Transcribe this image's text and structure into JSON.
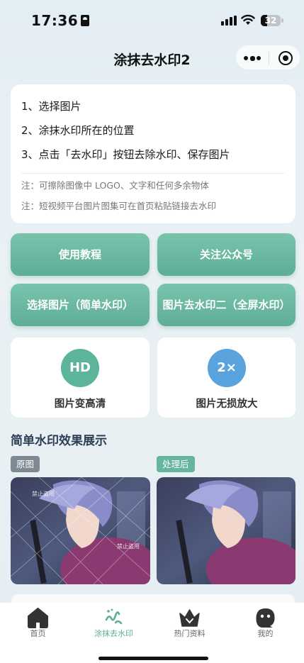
{
  "status_bar": {
    "time": "17:36",
    "battery": "32"
  },
  "nav": {
    "title": "涂抹去水印2"
  },
  "instructions": {
    "steps": [
      "1、选择图片",
      "2、涂抹水印所在的位置",
      "3、点击「去水印」按钮去除水印、保存图片"
    ],
    "notes": [
      "注：可擦除图像中 LOGO、文字和任何多余物体",
      "注：短视频平台图片图集可在首页粘贴链接去水印"
    ]
  },
  "buttons": {
    "tutorial": "使用教程",
    "follow": "关注公众号",
    "select_simple": "选择图片（简单水印）",
    "remove_full": "图片去水印二（全屏水印）"
  },
  "features": {
    "hd": {
      "badge": "HD",
      "label": "图片变高清",
      "color": "#5cb49a"
    },
    "upscale": {
      "badge": "2×",
      "label": "图片无损放大",
      "color": "#5aa3dc"
    }
  },
  "demo": {
    "title": "简单水印效果展示",
    "original_tag": "原图",
    "processed_tag": "处理后",
    "watermark_text": "禁止盗用"
  },
  "colors": {
    "accent": "#5eae96",
    "tag_gray": "#7d8a93",
    "tag_green": "#66b59c"
  },
  "tabs": [
    {
      "label": "首页",
      "icon": "home-icon",
      "active": false
    },
    {
      "label": "涂抹去水印",
      "icon": "brush-icon",
      "active": true
    },
    {
      "label": "热门资料",
      "icon": "crown-icon",
      "active": false
    },
    {
      "label": "我的",
      "icon": "profile-icon",
      "active": false
    }
  ]
}
